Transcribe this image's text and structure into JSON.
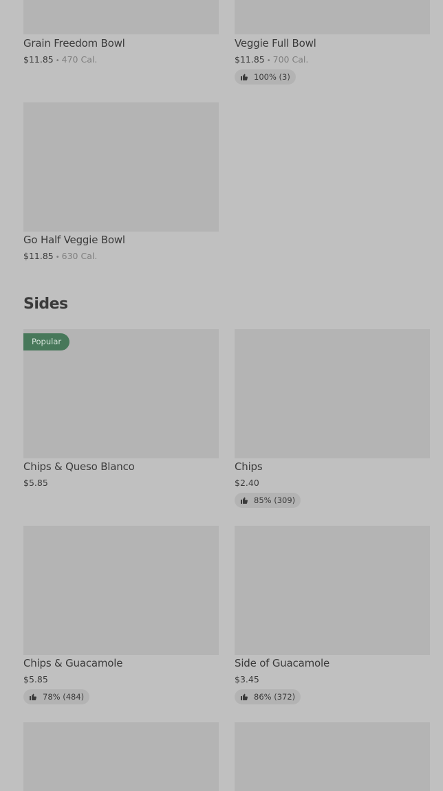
{
  "bowls": [
    {
      "name": "Grain Freedom Bowl",
      "price": "$11.85",
      "calories": "470 Cal.",
      "rating": ""
    },
    {
      "name": "Veggie Full Bowl",
      "price": "$11.85",
      "calories": "700 Cal.",
      "rating": "100% (3)"
    },
    {
      "name": "Go Half Veggie Bowl",
      "price": "$11.85",
      "calories": "630 Cal.",
      "rating": ""
    }
  ],
  "sides_section": {
    "title": "Sides",
    "items": [
      {
        "name": "Chips & Queso Blanco",
        "price": "$5.85",
        "badge": "Popular",
        "rating": ""
      },
      {
        "name": "Chips",
        "price": "$2.40",
        "rating": "85% (309)"
      },
      {
        "name": "Chips & Guacamole",
        "price": "$5.85",
        "rating": "78% (484)"
      },
      {
        "name": "Side of Guacamole",
        "price": "$3.45",
        "rating": "86% (372)"
      }
    ]
  },
  "separator": "•",
  "icons": {
    "rating": "thumbs-up-icon"
  },
  "colors": {
    "background": "#c0c0c0",
    "image_placeholder": "#b4b4b4",
    "badge": "#47785a",
    "rating_pill": "#b3b3b3"
  }
}
